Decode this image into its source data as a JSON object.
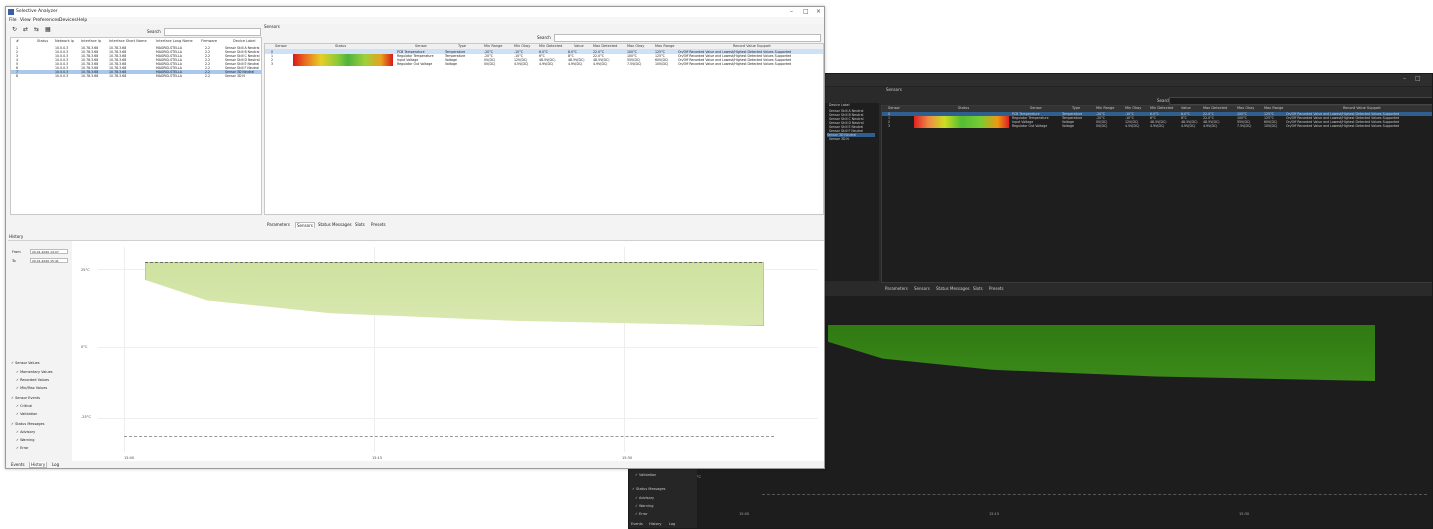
{
  "light": {
    "title": "Selective Analyzer",
    "window_controls": [
      "–",
      "□",
      "×"
    ],
    "menu": [
      "File",
      "View",
      "Preferences",
      "Devices",
      "Help"
    ],
    "toolbar_icons": [
      "refresh-icon",
      "connect-icon",
      "disconnect-icon",
      "grid-icon"
    ],
    "search_label": "Search",
    "device_table": {
      "columns": [
        "#",
        "Status",
        "Network Ip",
        "Interface Ip",
        "Interface Short Name",
        "Interface Long Name",
        "Firmware",
        "Device Label"
      ],
      "rows": [
        [
          "1",
          "",
          "10.0.0.3",
          "10.78.3.68",
          "10.78.3.68",
          "MAGRID-STELLA",
          "2.2",
          "Sensor Skill A Neutral"
        ],
        [
          "2",
          "",
          "10.0.0.3",
          "10.78.3.68",
          "10.78.3.68",
          "MAGRID-STELLA",
          "2.2",
          "Sensor Skill B Neutral"
        ],
        [
          "3",
          "",
          "10.0.0.3",
          "10.78.3.68",
          "10.78.3.68",
          "MAGRID-STELLA",
          "2.2",
          "Sensor Skill C Neutral"
        ],
        [
          "4",
          "",
          "10.0.0.3",
          "10.78.3.68",
          "10.78.3.68",
          "MAGRID-STELLA",
          "2.2",
          "Sensor Skill D Neutral"
        ],
        [
          "5",
          "",
          "10.0.0.3",
          "10.78.3.68",
          "10.78.3.68",
          "MAGRID-STELLA",
          "2.2",
          "Sensor Skill E Neutral"
        ],
        [
          "6",
          "",
          "10.0.0.3",
          "10.78.3.68",
          "10.78.3.68",
          "MAGRID-STELLA",
          "2.2",
          "Sensor Skill F Neutral"
        ],
        [
          "7",
          "",
          "10.0.0.3",
          "10.78.3.68",
          "10.78.3.68",
          "MAGRID-STELLA",
          "2.2",
          "Sensor 3D Neutral"
        ],
        [
          "8",
          "",
          "10.0.0.3",
          "10.78.3.68",
          "10.78.3.68",
          "MAGRID-STELLA",
          "2.2",
          "Sensor 3D N"
        ]
      ]
    },
    "sensors_title": "Sensors",
    "sensor_table": {
      "columns": [
        "Sensor",
        "Status",
        "Sensor",
        "Type",
        "Min Range",
        "Min Okay",
        "Min Detected",
        "Value",
        "Max Detected",
        "Max Okay",
        "Max Range",
        "Record Value Support"
      ],
      "rows": [
        [
          "0",
          "",
          "PCB Temperature",
          "Temperature",
          "-20°C",
          "-10°C",
          "6.0°C",
          "8.0°C",
          "22.0°C",
          "100°C",
          "125°C",
          "On/Off Recorded Value and Lowest/Highest Detected Values Supported"
        ],
        [
          "1",
          "",
          "Regulator Temperature",
          "Temperature",
          "-20°C",
          "-10°C",
          "6°C",
          "8°C",
          "22.0°C",
          "100°C",
          "125°C",
          "On/Off Recorded Value and Lowest/Highest Detected Values Supported"
        ],
        [
          "2",
          "",
          "Input Voltage",
          "Voltage",
          "0V(DC)",
          "12V(DC)",
          "48.5V(DC)",
          "48.5V(DC)",
          "48.5V(DC)",
          "55V(DC)",
          "60V(DC)",
          "On/Off Recorded Value and Lowest/Highest Detected Values Supported"
        ],
        [
          "3",
          "",
          "Regulator Out Voltage",
          "Voltage",
          "0V(DC)",
          "4.5V(DC)",
          "4.9V(DC)",
          "4.9V(DC)",
          "4.9V(DC)",
          "7.5V(DC)",
          "10V(DC)",
          "On/Off Recorded Value and Lowest/Highest Detected Values Supported"
        ]
      ]
    },
    "tabs": [
      "Parameters",
      "Sensors",
      "Status Messages",
      "Slots",
      "Presets"
    ],
    "active_tab": "Sensors",
    "history_title": "History",
    "from_label": "From",
    "from_value": "20.01.2020 14:07",
    "to_label": "To",
    "to_value": "20.01.2020 15:41",
    "checkboxes": [
      {
        "label": "Sensor Values",
        "checked": true,
        "indent": 0
      },
      {
        "label": "Momentary Values",
        "checked": true,
        "indent": 1
      },
      {
        "label": "Recorded Values",
        "checked": true,
        "indent": 1
      },
      {
        "label": "Min/Max Values",
        "checked": true,
        "indent": 1
      },
      {
        "label": "Sensor Events",
        "checked": true,
        "indent": 0
      },
      {
        "label": "Critical",
        "checked": true,
        "indent": 1
      },
      {
        "label": "Validation",
        "checked": true,
        "indent": 1
      },
      {
        "label": "Status Messages",
        "checked": true,
        "indent": 0
      },
      {
        "label": "Advisory",
        "checked": true,
        "indent": 1
      },
      {
        "label": "Warning",
        "checked": true,
        "indent": 1
      },
      {
        "label": "Error",
        "checked": true,
        "indent": 1
      }
    ],
    "y_ticks": [
      "25°C",
      "0°C",
      "-25°C"
    ],
    "x_ticks": [
      "15:00",
      "15:15",
      "15:30"
    ],
    "bottom_tabs": [
      "Events",
      "History",
      "Log"
    ],
    "active_bottom_tab": "History"
  },
  "dark": {
    "window_controls": [
      "–",
      "□",
      "×"
    ],
    "sensors_title": "Sensors",
    "search_label": "Search",
    "device_label_header": "Device Label",
    "device_labels": [
      "Sensor Skill A Neutral",
      "Sensor Skill B Neutral",
      "Sensor Skill C Neutral",
      "Sensor Skill D Neutral",
      "Sensor Skill E Neutral",
      "Sensor Skill F Neutral",
      "Sensor 3D Neutral",
      "Sensor 3D N"
    ],
    "sensor_columns": [
      "Sensor",
      "Status",
      "Sensor",
      "Type",
      "Min Range",
      "Min Okay",
      "Min Detected",
      "Value",
      "Max Detected",
      "Max Okay",
      "Max Range",
      "Record Value Support"
    ],
    "sensor_rows": [
      [
        "0",
        "PCB Temperature",
        "Temperature",
        "-20°C",
        "-10°C",
        "6.0°C",
        "8.0°C",
        "22.0°C",
        "100°C",
        "125°C",
        "On/Off Recorded Value and Lowest/Highest Detected Values Supported"
      ],
      [
        "1",
        "Regulator Temperature",
        "Temperature",
        "-20°C",
        "-10°C",
        "6°C",
        "8°C",
        "22.0°C",
        "100°C",
        "125°C",
        "On/Off Recorded Value and Lowest/Highest Detected Values Supported"
      ],
      [
        "2",
        "Input Voltage",
        "Voltage",
        "0V(DC)",
        "12V(DC)",
        "48.5V(DC)",
        "48.5V(DC)",
        "48.5V(DC)",
        "55V(DC)",
        "60V(DC)",
        "On/Off Recorded Value and Lowest/Highest Detected Values Supported"
      ],
      [
        "3",
        "Regulator Out Voltage",
        "Voltage",
        "0V(DC)",
        "4.5V(DC)",
        "4.9V(DC)",
        "4.9V(DC)",
        "4.9V(DC)",
        "7.5V(DC)",
        "10V(DC)",
        "On/Off Recorded Value and Lowest/Highest Detected Values Supported"
      ]
    ],
    "tabs": [
      "Parameters",
      "Sensors",
      "Status Messages",
      "Slots",
      "Presets"
    ],
    "checkboxes": [
      "Validation",
      "Status Messages",
      "Advisory",
      "Warning",
      "Error"
    ],
    "y_tick": "-25°C",
    "x_ticks": [
      "15:00",
      "15:15",
      "15:30"
    ],
    "bottom_tabs": [
      "Events",
      "History",
      "Log"
    ]
  },
  "colors": {
    "accent_selection": "#a9c8ec",
    "dark_selection": "#2f5f8f",
    "light_area": "#d9e8b0",
    "dark_area": "#3c8a1a"
  }
}
